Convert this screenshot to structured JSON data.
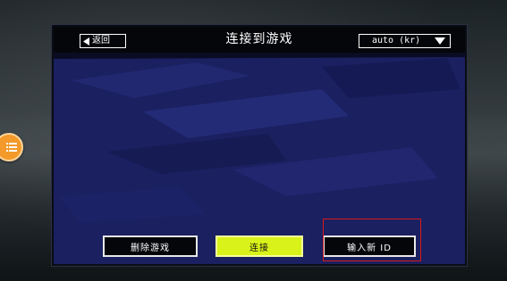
{
  "header": {
    "back_label": "返回",
    "title": "连接到游戏",
    "region_value": "auto (kr)"
  },
  "actions": {
    "delete_label": "删除游戏",
    "connect_label": "连接",
    "new_id_label": "输入新 ID"
  },
  "colors": {
    "panel_bg": "#1a2060",
    "header_bg": "#05060a",
    "connect_accent": "#d9f21a",
    "highlight_border": "#d61a1a",
    "side_menu": "#f39a2a"
  },
  "icons": {
    "back": "back-arrow-icon",
    "dropdown": "chevron-down-icon",
    "side_menu": "list-menu-icon"
  }
}
